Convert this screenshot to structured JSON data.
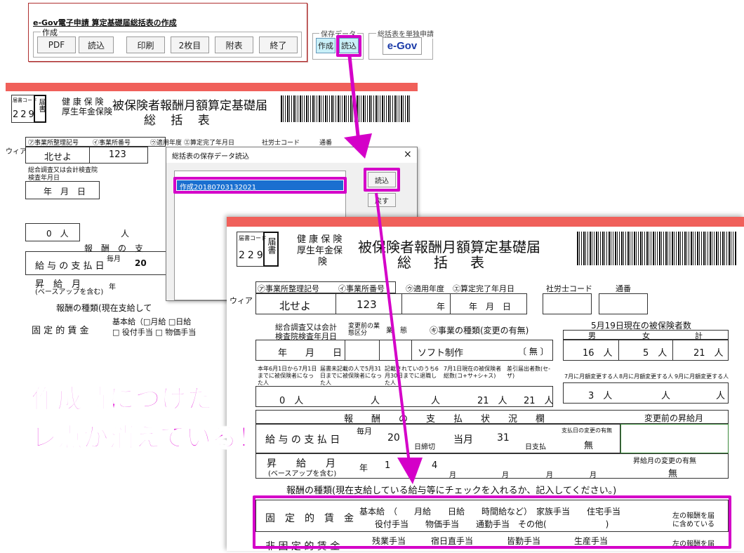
{
  "toolbar": {
    "title": "e-Gov電子申請 算定基礎届総括表の作成",
    "group_label": "作成",
    "buttons": [
      "PDF",
      "読込",
      "印刷",
      "2枚目",
      "附表",
      "終了"
    ],
    "save_group_label": "保存データ",
    "save_buttons": [
      "作成",
      "読込"
    ],
    "single_group_label": "総括表を単独申請",
    "egov_logo": "e-Gov"
  },
  "form_back": {
    "form_code_label": "届書コード",
    "form_code": "229",
    "form_type": "届書",
    "insurance_1": "健 康 保 険",
    "insurance_2": "厚生年金保険",
    "form_title_1": "被保険者報酬月額算定基礎届",
    "form_title_2": "総 括 表",
    "side_label": "ウィア",
    "company": "北せよ",
    "office_no": "123",
    "labels": [
      "㋐事業所整理記号",
      "㋑事業所番号",
      "㋒適用年度",
      "㋓算定完了年月日",
      "社労士コード",
      "通番"
    ],
    "survey_label": "総合調査又は会計検査院検査年月日",
    "ymd": "年　月　日",
    "zero_people": "0　人",
    "person": "人",
    "kyuyo": "給 与 の 支 払 日",
    "maitsuki": "毎月",
    "day20": "20",
    "shokyu": "昇　給　月",
    "baseup": "(ベースアップを含む)",
    "nen": "年",
    "housyu_kind": "報酬の種類(現在支給して",
    "kotei": "固 定 的 賃 金",
    "kihonkyu": "基本給（□月給 □日給",
    "yakutsuki": "□ 役付手当 □ 物価手当",
    "housyu": "報　酬　の　支"
  },
  "dialog": {
    "title": "総括表の保存データ読込",
    "close": "×",
    "list_items": [
      "作成20180703132021"
    ],
    "load_button": "読込",
    "back_button": "戻す"
  },
  "form_front": {
    "form_code_label": "届書コード",
    "form_code": "229",
    "form_type": "届書",
    "insurance_1": "健 康 保 険",
    "insurance_2": "厚生年金保",
    "insurance_3": "険",
    "form_title_1": "被保険者報酬月額算定基礎届",
    "form_title_2": "総　括　表",
    "side_label": "ウィア",
    "labels": {
      "seiri": "㋐事業所整理記号",
      "bango": "㋑事業所番号",
      "nendo": "㋒適用年度",
      "kanryo": "㋓算定完了年月日",
      "sharoshi": "社労士コード",
      "tsuban": "通番"
    },
    "company": "北せよ",
    "office_no": "123",
    "nen": "年",
    "nengappi": "年　月　日",
    "survey_label_1": "総合調査又は会計",
    "survey_label_2": "検査院検査年月日",
    "survey_date": "年　　月　　日",
    "henko_mae": "変更前の業態区分",
    "gyotai": "業　態",
    "shurui_label": "㋖事業の種類(変更の有無)",
    "shurui_value": "ソフト制作",
    "shurui_change": "〔 無 〕",
    "count_title": "5月19日現在の被保険者数",
    "male": "男",
    "female": "女",
    "total": "計",
    "male_count": "16　人",
    "female_count": "5　人",
    "total_count": "21　人",
    "col_kashikyu": "本年6月1日から7月1日までに被保険者になった人",
    "col_ikou": "届書未記載の人で5月31日までに被保険者になった人",
    "col_30": "記載されていのうち6月30日までに退職した人",
    "col_7": "7月1日現在の被保険者総数(コ+サ+シ+ス)",
    "col_sashihiki": "差引届出者数(セ-ザ)",
    "col_7kai": "7月に月額変更する人",
    "col_8kai": "8月に月額変更する人",
    "col_9kai": "9月に月額変更する人",
    "zero": "0　人",
    "person": "人",
    "v21a": "21　人",
    "v21b": "21　人",
    "v3": "3　人",
    "housyu_header": "報　　酬　　の　　支　　払　　状　　況　　欄",
    "shokyu_before": "変更前の昇給月",
    "kyuyo_label": "給 与 の 支 払 日",
    "maitsuki": "毎月",
    "shime_day": "20",
    "shimekiri": "日締切",
    "togetsu": "当月",
    "shiharai_day": "31",
    "shiharai": "日支払",
    "shiharai_change_label": "支払日の変更の有無",
    "nashi": "無",
    "shokyu_label": "昇　　給　　月",
    "baseup": "(ベースアップを含む)",
    "shokyu_row": [
      "年",
      "1",
      "4",
      "月",
      "月",
      "月",
      "月"
    ],
    "shokyu_change_label": "昇給月の変更の有無",
    "nashi2": "無",
    "housyu_kind": "報酬の種類(現在支給している給与等にチェックを入れるか、記入してください。)",
    "kotei_label": "固　定　的　賃　金",
    "kotei_line1": "基本給　（　　月給　　日給　　時間給など）　家族手当　　住宅手当",
    "kotei_line2": "役付手当　　物価手当　　通勤手当　その他(　　　　　　　)",
    "hidari_1": "左の報酬を届",
    "hidari_2": "に含めている",
    "hikotei_label": "非 固 定 的 賃 金",
    "hikotei_line": "残業手当　　　宿日直手当　　　　皆勤手当　　　　生産手当",
    "hidari_3": "左の報酬を届"
  },
  "annotation": {
    "line1": "作成時につけた",
    "line2": "レ点が消えている！"
  },
  "colors": {
    "accent": "#d400c8",
    "red_bar": "#f0605a",
    "egov_blue": "#1a3aa8"
  }
}
